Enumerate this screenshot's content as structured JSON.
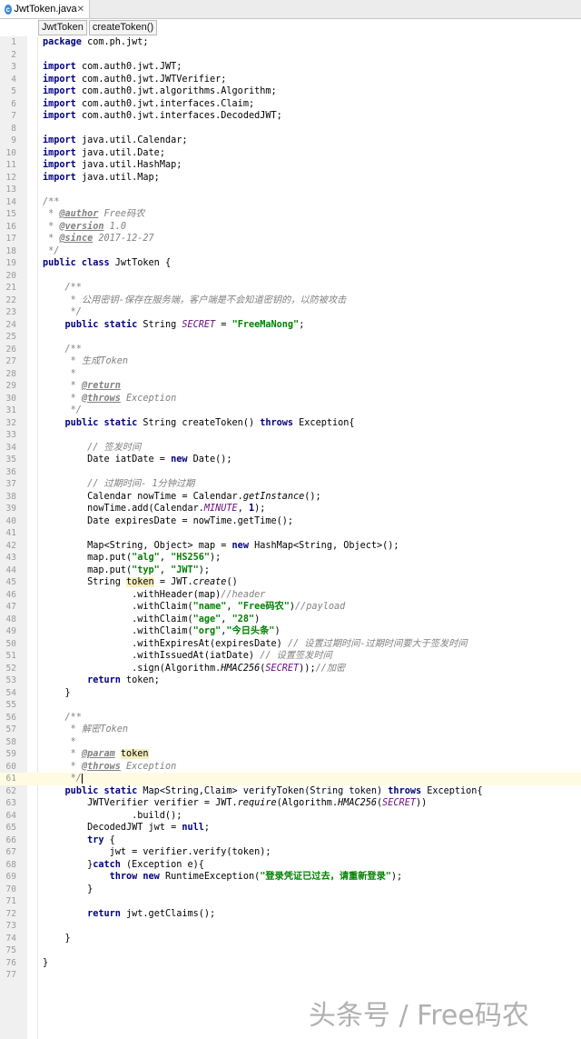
{
  "tab": {
    "title": "JwtToken.java",
    "close": "✕",
    "icon": "class-icon"
  },
  "breadcrumb": [
    "JwtToken",
    "createToken()"
  ],
  "current_line": 61,
  "lines": [
    [
      [
        "kw",
        "package"
      ],
      [
        "t",
        " com.ph.jwt;"
      ]
    ],
    [],
    [
      [
        "kw",
        "import"
      ],
      [
        "t",
        " com.auth0.jwt.JWT;"
      ]
    ],
    [
      [
        "kw",
        "import"
      ],
      [
        "t",
        " com.auth0.jwt.JWTVerifier;"
      ]
    ],
    [
      [
        "kw",
        "import"
      ],
      [
        "t",
        " com.auth0.jwt.algorithms.Algorithm;"
      ]
    ],
    [
      [
        "kw",
        "import"
      ],
      [
        "t",
        " com.auth0.jwt.interfaces.Claim;"
      ]
    ],
    [
      [
        "kw",
        "import"
      ],
      [
        "t",
        " com.auth0.jwt.interfaces.DecodedJWT;"
      ]
    ],
    [],
    [
      [
        "kw",
        "import"
      ],
      [
        "t",
        " java.util.Calendar;"
      ]
    ],
    [
      [
        "kw",
        "import"
      ],
      [
        "t",
        " java.util.Date;"
      ]
    ],
    [
      [
        "kw",
        "import"
      ],
      [
        "t",
        " java.util.HashMap;"
      ]
    ],
    [
      [
        "kw",
        "import"
      ],
      [
        "t",
        " java.util.Map;"
      ]
    ],
    [],
    [
      [
        "cm",
        "/**"
      ]
    ],
    [
      [
        "cm",
        " * "
      ],
      [
        "tag",
        "@author"
      ],
      [
        "cm",
        " Free码农"
      ]
    ],
    [
      [
        "cm",
        " * "
      ],
      [
        "tag",
        "@version"
      ],
      [
        "cm",
        " 1.0"
      ]
    ],
    [
      [
        "cm",
        " * "
      ],
      [
        "tag",
        "@since"
      ],
      [
        "cm",
        " 2017-12-27"
      ]
    ],
    [
      [
        "cm",
        " */"
      ]
    ],
    [
      [
        "kw",
        "public class"
      ],
      [
        "t",
        " JwtToken {"
      ]
    ],
    [],
    [
      [
        "cm",
        "    /**"
      ]
    ],
    [
      [
        "cm",
        "     * 公用密钥-保存在服务端，客户端是不会知道密钥的，以防被攻击"
      ]
    ],
    [
      [
        "cm",
        "     */"
      ]
    ],
    [
      [
        "t",
        "    "
      ],
      [
        "kw",
        "public static"
      ],
      [
        "t",
        " String "
      ],
      [
        "sf",
        "SECRET"
      ],
      [
        "t",
        " = "
      ],
      [
        "str",
        "\"FreeMaNong\""
      ],
      [
        "t",
        ";"
      ]
    ],
    [],
    [
      [
        "cm",
        "    /**"
      ]
    ],
    [
      [
        "cm",
        "     * 生成Token"
      ]
    ],
    [
      [
        "cm",
        "     *"
      ]
    ],
    [
      [
        "cm",
        "     * "
      ],
      [
        "tag",
        "@return"
      ]
    ],
    [
      [
        "cm",
        "     * "
      ],
      [
        "tag",
        "@throws"
      ],
      [
        "cm",
        " Exception"
      ]
    ],
    [
      [
        "cm",
        "     */"
      ]
    ],
    [
      [
        "t",
        "    "
      ],
      [
        "kw",
        "public static"
      ],
      [
        "t",
        " String createToken() "
      ],
      [
        "kw",
        "throws"
      ],
      [
        "t",
        " Exception{"
      ]
    ],
    [],
    [
      [
        "cm",
        "        // 签发时间"
      ]
    ],
    [
      [
        "t",
        "        Date iatDate = "
      ],
      [
        "kw",
        "new"
      ],
      [
        "t",
        " Date();"
      ]
    ],
    [],
    [
      [
        "cm",
        "        // 过期时间- 1分钟过期"
      ]
    ],
    [
      [
        "t",
        "        Calendar nowTime = Calendar."
      ],
      [
        "it",
        "getInstance"
      ],
      [
        "t",
        "();"
      ]
    ],
    [
      [
        "t",
        "        nowTime.add(Calendar."
      ],
      [
        "sf",
        "MINUTE"
      ],
      [
        "t",
        ", "
      ],
      [
        "kw",
        "1"
      ],
      [
        "t",
        ");"
      ]
    ],
    [
      [
        "t",
        "        Date expiresDate = nowTime.getTime();"
      ]
    ],
    [],
    [
      [
        "t",
        "        Map<String, Object> map = "
      ],
      [
        "kw",
        "new"
      ],
      [
        "t",
        " HashMap<String, Object>();"
      ]
    ],
    [
      [
        "t",
        "        map.put("
      ],
      [
        "str",
        "\"alg\""
      ],
      [
        "t",
        ", "
      ],
      [
        "str",
        "\"HS256\""
      ],
      [
        "t",
        ");"
      ]
    ],
    [
      [
        "t",
        "        map.put("
      ],
      [
        "str",
        "\"typ\""
      ],
      [
        "t",
        ", "
      ],
      [
        "str",
        "\"JWT\""
      ],
      [
        "t",
        ");"
      ]
    ],
    [
      [
        "t",
        "        String "
      ],
      [
        "hl",
        "token"
      ],
      [
        "t",
        " = JWT."
      ],
      [
        "it",
        "create"
      ],
      [
        "t",
        "()"
      ]
    ],
    [
      [
        "t",
        "                .withHeader(map)"
      ],
      [
        "cm",
        "//header"
      ]
    ],
    [
      [
        "t",
        "                .withClaim("
      ],
      [
        "str",
        "\"name\""
      ],
      [
        "t",
        ", "
      ],
      [
        "str",
        "\"Free码农\""
      ],
      [
        "t",
        ")"
      ],
      [
        "cm",
        "//payload"
      ]
    ],
    [
      [
        "t",
        "                .withClaim("
      ],
      [
        "str",
        "\"age\""
      ],
      [
        "t",
        ", "
      ],
      [
        "str",
        "\"28\""
      ],
      [
        "t",
        ")"
      ]
    ],
    [
      [
        "t",
        "                .withClaim("
      ],
      [
        "str",
        "\"org\""
      ],
      [
        "t",
        ","
      ],
      [
        "str",
        "\"今日头条\""
      ],
      [
        "t",
        ")"
      ]
    ],
    [
      [
        "t",
        "                .withExpiresAt(expiresDate) "
      ],
      [
        "cm",
        "// 设置过期时间-过期时间要大于签发时间"
      ]
    ],
    [
      [
        "t",
        "                .withIssuedAt(iatDate) "
      ],
      [
        "cm",
        "// 设置签发时间"
      ]
    ],
    [
      [
        "t",
        "                .sign(Algorithm."
      ],
      [
        "it",
        "HMAC256"
      ],
      [
        "t",
        "("
      ],
      [
        "sf",
        "SECRET"
      ],
      [
        "t",
        "));"
      ],
      [
        "cm",
        "//加密"
      ]
    ],
    [
      [
        "t",
        "        "
      ],
      [
        "kw",
        "return"
      ],
      [
        "t",
        " token;"
      ]
    ],
    [
      [
        "t",
        "    }"
      ]
    ],
    [],
    [
      [
        "cm",
        "    /**"
      ]
    ],
    [
      [
        "cm",
        "     * 解密Token"
      ]
    ],
    [
      [
        "cm",
        "     *"
      ]
    ],
    [
      [
        "cm",
        "     * "
      ],
      [
        "tag",
        "@param"
      ],
      [
        "cm",
        " "
      ],
      [
        "hl",
        "token"
      ]
    ],
    [
      [
        "cm",
        "     * "
      ],
      [
        "tag",
        "@throws"
      ],
      [
        "cm",
        " Exception"
      ]
    ],
    [
      [
        "cm",
        "     */"
      ],
      [
        "caret",
        ""
      ]
    ],
    [
      [
        "t",
        "    "
      ],
      [
        "kw",
        "public static"
      ],
      [
        "t",
        " Map<String,Claim> verifyToken(String token) "
      ],
      [
        "kw",
        "throws"
      ],
      [
        "t",
        " Exception{"
      ]
    ],
    [
      [
        "t",
        "        JWTVerifier verifier = JWT."
      ],
      [
        "it",
        "require"
      ],
      [
        "t",
        "(Algorithm."
      ],
      [
        "it",
        "HMAC256"
      ],
      [
        "t",
        "("
      ],
      [
        "sf",
        "SECRET"
      ],
      [
        "t",
        "))"
      ]
    ],
    [
      [
        "t",
        "                .build();"
      ]
    ],
    [
      [
        "t",
        "        DecodedJWT jwt = "
      ],
      [
        "kw",
        "null"
      ],
      [
        "t",
        ";"
      ]
    ],
    [
      [
        "t",
        "        "
      ],
      [
        "kw",
        "try"
      ],
      [
        "t",
        " {"
      ]
    ],
    [
      [
        "t",
        "            jwt = verifier.verify(token);"
      ]
    ],
    [
      [
        "t",
        "        }"
      ],
      [
        "kw",
        "catch"
      ],
      [
        "t",
        " (Exception e){"
      ]
    ],
    [
      [
        "t",
        "            "
      ],
      [
        "kw",
        "throw new"
      ],
      [
        "t",
        " RuntimeException("
      ],
      [
        "str",
        "\"登录凭证已过去，请重新登录\""
      ],
      [
        "t",
        ");"
      ]
    ],
    [
      [
        "t",
        "        }"
      ]
    ],
    [],
    [
      [
        "t",
        "        "
      ],
      [
        "kw",
        "return"
      ],
      [
        "t",
        " jwt.getClaims();"
      ]
    ],
    [],
    [
      [
        "t",
        "    }"
      ]
    ],
    [],
    [
      [
        "t",
        "}"
      ]
    ],
    []
  ],
  "watermark": "头条号 / Free码农"
}
